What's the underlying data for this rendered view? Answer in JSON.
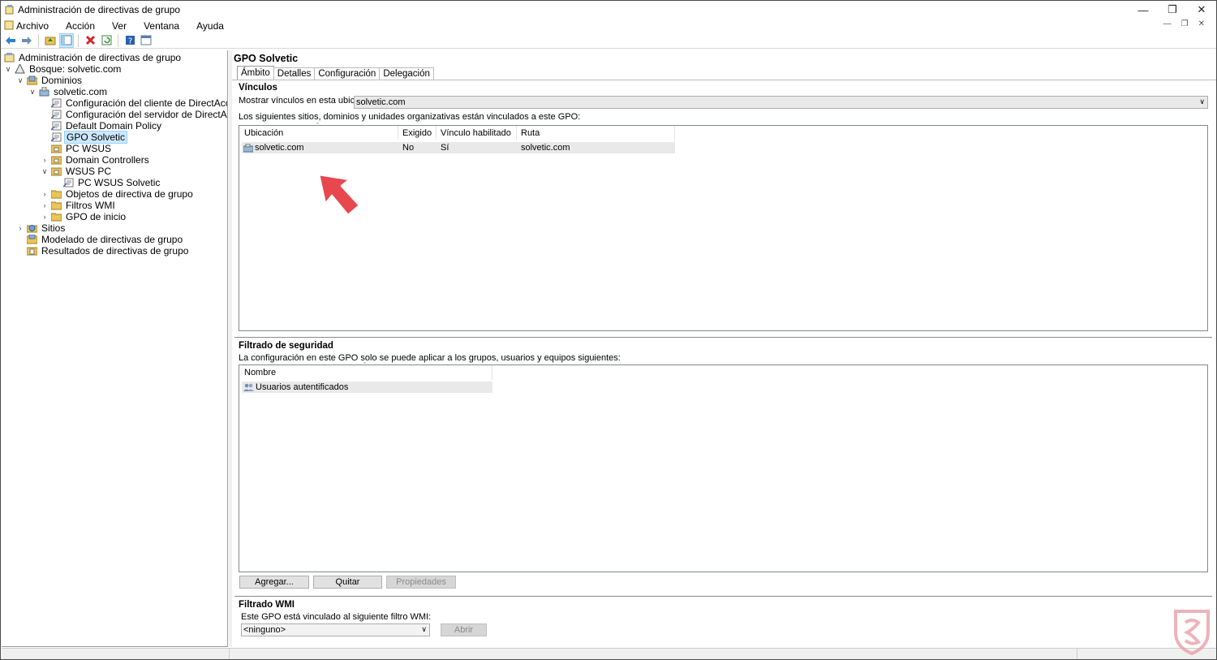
{
  "window": {
    "title": "Administración de directivas de grupo"
  },
  "menu": [
    "Archivo",
    "Acción",
    "Ver",
    "Ventana",
    "Ayuda"
  ],
  "tree": {
    "root": "Administración de directivas de grupo",
    "forest": "Bosque: solvetic.com",
    "domains": "Dominios",
    "domain": "solvetic.com",
    "items": [
      "Configuración del cliente de DirectAccess",
      "Configuración del servidor de DirectAccess",
      "Default Domain Policy",
      "GPO Solvetic",
      "PC WSUS",
      "Domain Controllers",
      "WSUS PC",
      "PC WSUS Solvetic",
      "Objetos de directiva de grupo",
      "Filtros WMI",
      "GPO de inicio"
    ],
    "sites": "Sitios",
    "modeling": "Modelado de directivas de grupo",
    "results": "Resultados de directivas de grupo"
  },
  "gpo": {
    "title": "GPO Solvetic",
    "tabs": [
      "Ámbito",
      "Detalles",
      "Configuración",
      "Delegación"
    ],
    "links": {
      "title": "Vínculos",
      "show_label": "Mostrar vínculos en esta ubicación:",
      "location": "solvetic.com",
      "desc": "Los siguientes sitios, dominios y unidades organizativas están vinculados a este GPO:",
      "columns": [
        "Ubicación",
        "Exigido",
        "Vínculo habilitado",
        "Ruta"
      ],
      "rows": [
        [
          "solvetic.com",
          "No",
          "Sí",
          "solvetic.com"
        ]
      ]
    },
    "security": {
      "title": "Filtrado de seguridad",
      "desc": "La configuración en este GPO solo se puede aplicar a los grupos, usuarios y equipos siguientes:",
      "column": "Nombre",
      "rows": [
        "Usuarios autentificados"
      ],
      "add": "Agregar...",
      "remove": "Quitar",
      "properties": "Propiedades"
    },
    "wmi": {
      "title": "Filtrado WMI",
      "desc": "Este GPO está vinculado al siguiente filtro WMI:",
      "value": "<ninguno>",
      "open": "Abrir"
    }
  },
  "colors": {
    "selection": "#cce8ff",
    "arrow": "#e8474d"
  }
}
